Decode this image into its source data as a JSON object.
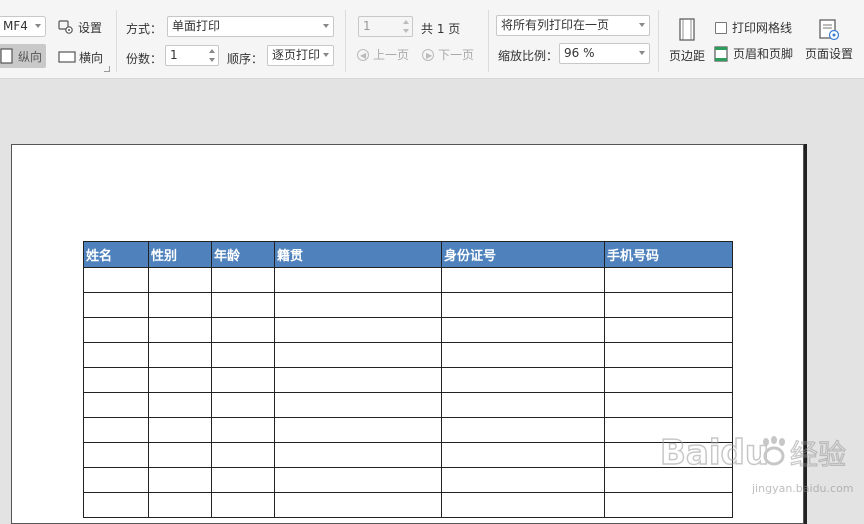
{
  "toolbar": {
    "paper_size": "MF4",
    "settings_label": "设置",
    "portrait_label": "纵向",
    "landscape_label": "横向",
    "mode_label": "方式：",
    "mode_value": "单面打印",
    "copies_label": "份数：",
    "copies_value": "1",
    "order_label": "顺序：",
    "order_value": "逐页打印",
    "page_value": "1",
    "total_pages": "共 1 页",
    "prev_page": "上一页",
    "next_page": "下一页",
    "fit_option": "将所有列打印在一页",
    "zoom_label": "缩放比例：",
    "zoom_value": "96 %",
    "margins_label": "页边距",
    "print_gridlines_label": "打印网格线",
    "header_footer_label": "页眉和页脚",
    "page_setup_label": "页面设置"
  },
  "sheet": {
    "headers": [
      "姓名",
      "性别",
      "年龄",
      "籍贯",
      "身份证号",
      "手机号码"
    ],
    "empty_rows": 10,
    "header_color": "#4f81bd"
  },
  "watermark": {
    "brand": "Baidu",
    "brand_suffix": "经验",
    "url": "jingyan.baidu.com"
  }
}
